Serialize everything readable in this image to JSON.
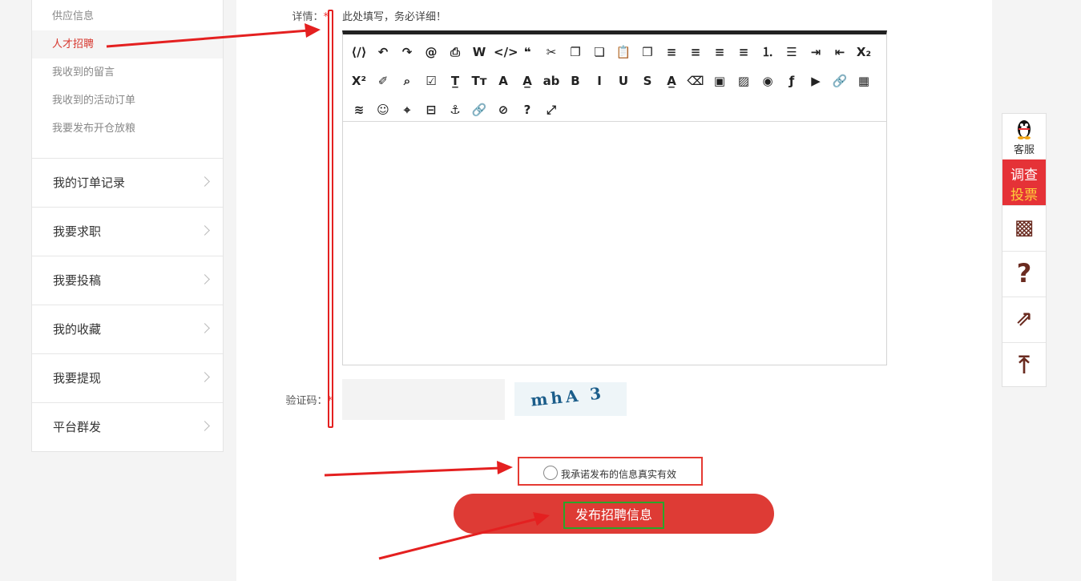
{
  "sidebar": {
    "sub_items": [
      "供应信息",
      "人才招聘",
      "我收到的留言",
      "我收到的活动订单",
      "我要发布开仓放粮"
    ],
    "menu": [
      "我的订单记录",
      "我要求职",
      "我要投稿",
      "我的收藏",
      "我要提现",
      "平台群发"
    ]
  },
  "form": {
    "detail_label": "详情：",
    "required_mark": "*",
    "detail_hint": "此处填写，务必详细！",
    "captcha_label": "验证码：",
    "captcha_text": "mhA 3",
    "agree_text": "我承诺发布的信息真实有效",
    "submit_label": "发布招聘信息"
  },
  "editor": {
    "toolbar_rows": [
      [
        "source-icon",
        "undo-icon",
        "redo-icon",
        "mention-icon",
        "print-icon",
        "word-icon",
        "code-icon",
        "quote-icon",
        "cut-icon",
        "copy-icon",
        "paste-format-icon",
        "paste-icon",
        "paste-word-icon",
        "align-left-icon",
        "align-center-icon",
        "align-right-icon",
        "align-justify-icon",
        "ordered-list-icon",
        "unordered-list-icon",
        "indent-icon",
        "outdent-icon",
        "subscript-icon"
      ],
      [
        "superscript-icon",
        "clear-format-icon",
        "select-all-icon",
        "checkbox-icon",
        "title-icon",
        "font-family-icon",
        "font-size-icon",
        "font-color-icon",
        "background-color-icon",
        "bold-icon",
        "italic-icon",
        "underline-icon",
        "strikethrough-icon",
        "line-height-icon",
        "eraser-icon",
        "image-icon",
        "multi-image-icon",
        "palette-icon",
        "flash-icon",
        "video-icon",
        "link-icon",
        "table-icon"
      ],
      [
        "hr-icon",
        "emoticon-icon",
        "map-icon",
        "page-break-icon",
        "anchor-icon",
        "insert-link-icon",
        "unlink-icon",
        "help-icon",
        "fullscreen-icon"
      ]
    ],
    "toolbar_glyphs": [
      [
        "⟨/⟩",
        "↶",
        "↷",
        "@",
        "⎙",
        "W",
        "</>",
        "❝",
        "✂",
        "❐",
        "❏",
        "📋",
        "❒",
        "≡",
        "≡",
        "≡",
        "≡",
        "⒈",
        "☰",
        "⇥",
        "⇤",
        "X₂"
      ],
      [
        "X²",
        "✐",
        "⌕",
        "☑",
        "T̲",
        "Tт",
        "A",
        "A̲",
        "ab",
        "B",
        "I",
        "U",
        "S",
        "A̲",
        "⌫",
        "▣",
        "▨",
        "◉",
        "ƒ",
        "▶",
        "🔗",
        "▦"
      ],
      [
        "≋",
        "☺",
        "⌖",
        "⊟",
        "⚓",
        "🔗",
        "⊘",
        "?",
        "⤢"
      ]
    ]
  },
  "float_bar": {
    "kefu_label": "客服",
    "vote_line1": "调查",
    "vote_line2": "投票",
    "qr_glyph": "▩",
    "help_glyph": "?",
    "share_glyph": "⇗",
    "top_glyph": "⤒"
  },
  "colors": {
    "accent_red": "#de3b35",
    "annotation_red": "#e42020",
    "annotation_green": "#2aa52a"
  }
}
